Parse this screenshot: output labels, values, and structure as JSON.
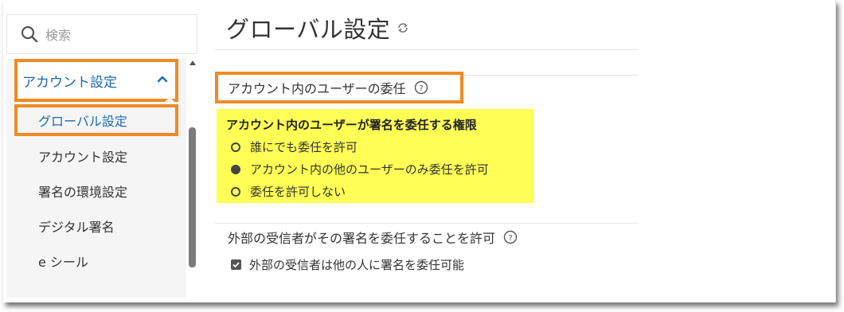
{
  "search": {
    "placeholder": "検索"
  },
  "sidebar": {
    "parent_label": "アカウント設定",
    "active_label": "グローバル設定",
    "items": [
      {
        "label": "アカウント設定"
      },
      {
        "label": "署名の環境設定"
      },
      {
        "label": "デジタル署名"
      },
      {
        "label": "e シール"
      }
    ]
  },
  "page": {
    "title": "グローバル設定"
  },
  "delegation": {
    "section_title": "アカウント内のユーザーの委任",
    "permission_heading": "アカウント内のユーザーが署名を委任する権限",
    "options": [
      {
        "label": "誰にでも委任を許可",
        "selected": false
      },
      {
        "label": "アカウント内の他のユーザーのみ委任を許可",
        "selected": true
      },
      {
        "label": "委任を許可しない",
        "selected": false
      }
    ]
  },
  "external": {
    "section_title": "外部の受信者がその署名を委任することを許可",
    "checkbox_label": "外部の受信者は他の人に署名を委任可能",
    "checked": true
  },
  "colors": {
    "highlight_border": "#f08a24",
    "highlight_fill": "#ffff55",
    "link_blue": "#1a6ab3"
  },
  "icons": [
    "search-icon",
    "chevron-up-icon",
    "refresh-icon",
    "help-icon",
    "checkbox-check-icon"
  ]
}
